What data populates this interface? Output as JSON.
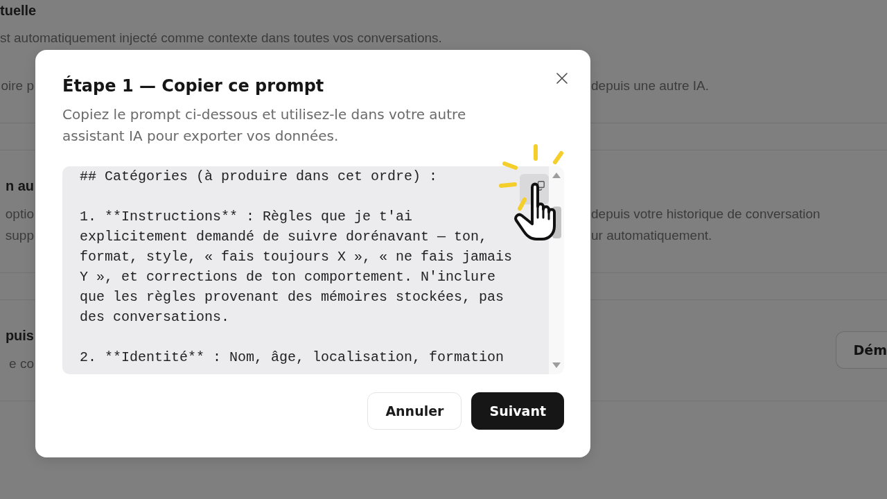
{
  "background": {
    "heading": "tuelle",
    "description": "st automatiquement injecté comme contexte dans toutes vos conversations.",
    "sections": [
      {
        "description_left": [
          "oire p"
        ],
        "description_right": [
          "depuis une autre IA."
        ]
      },
      {
        "title_left": "n au",
        "description_left": [
          "optio",
          "supp"
        ],
        "description_right": [
          "depuis votre historique de conversation",
          "ur automatiquement."
        ]
      },
      {
        "title_left": "puis",
        "description_left": [
          "e co"
        ],
        "button": "Dém"
      }
    ]
  },
  "dialog": {
    "title": "Étape 1 — Copier ce prompt",
    "subtitle": "Copiez le prompt ci-dessous et utilisez-le dans votre autre assistant IA pour exporter vos données.",
    "prompt_paragraphs": [
      "## Catégories (à produire dans cet ordre) :",
      "1. **Instructions** : Règles que je t'ai explicitement demandé de suivre dorénavant — ton, format, style, « fais toujours X », « ne fais jamais Y », et corrections de ton comportement. N'inclure que les règles provenant des mémoires stockées, pas des conversations.",
      "2. **Identité** : Nom, âge, localisation, formation"
    ],
    "buttons": [
      {
        "label": "Annuler",
        "kind": "secondary"
      },
      {
        "label": "Suivant",
        "kind": "primary"
      }
    ]
  }
}
